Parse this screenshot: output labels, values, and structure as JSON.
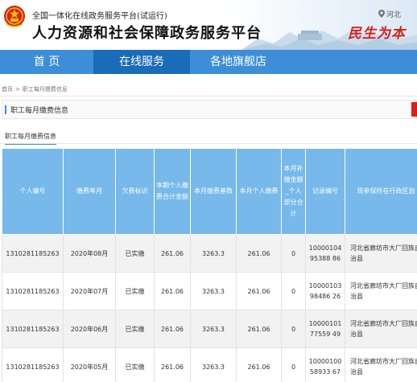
{
  "header": {
    "top_line": "全国一体化在线政务服务平台(试运行)",
    "title": "人力资源和社会保障政务服务平台",
    "region": "河北",
    "slogan": "民生为本"
  },
  "nav": {
    "items": [
      {
        "label": "首 页"
      },
      {
        "label": "在线服务"
      },
      {
        "label": "各地旗舰店"
      }
    ]
  },
  "breadcrumb": {
    "home": "首页",
    "sep": ">",
    "current": "职工每月缴费信息"
  },
  "panel": {
    "title": "职工每月缴费信息"
  },
  "tab": {
    "label": "职工每月缴费信息"
  },
  "table": {
    "headers": [
      "个人编号",
      "缴费年月",
      "欠费标识",
      "本期个人缴费合计金额",
      "本月缴费基数",
      "本月个人缴费",
      "本月补缴金额_个人部分合计",
      "记录编号",
      "现参保所在行政区划"
    ],
    "rows": [
      [
        "1310281185263",
        "2020年08月",
        "已实缴",
        "261.06",
        "3263.3",
        "261.06",
        "0",
        "1000010495388 86",
        "河北省廊坊市大厂回族自治县"
      ],
      [
        "1310281185263",
        "2020年07月",
        "已实缴",
        "261.06",
        "3263.3",
        "261.06",
        "0",
        "1000010398486 26",
        "河北省廊坊市大厂回族自治县"
      ],
      [
        "1310281185263",
        "2020年06月",
        "已实缴",
        "261.06",
        "3263.3",
        "261.06",
        "0",
        "1000010177559 49",
        "河北省廊坊市大厂回族自治县"
      ],
      [
        "1310281185263",
        "2020年05月",
        "已实缴",
        "261.06",
        "3263.3",
        "261.06",
        "0",
        "1000010058933 67",
        "河北省廊坊市大厂回族自治县"
      ]
    ]
  },
  "colors": {
    "nav_bg": "#3d8ed7",
    "nav_active": "#1a6bb8",
    "table_header": "#76b9ea",
    "slogan": "#d8201b"
  }
}
